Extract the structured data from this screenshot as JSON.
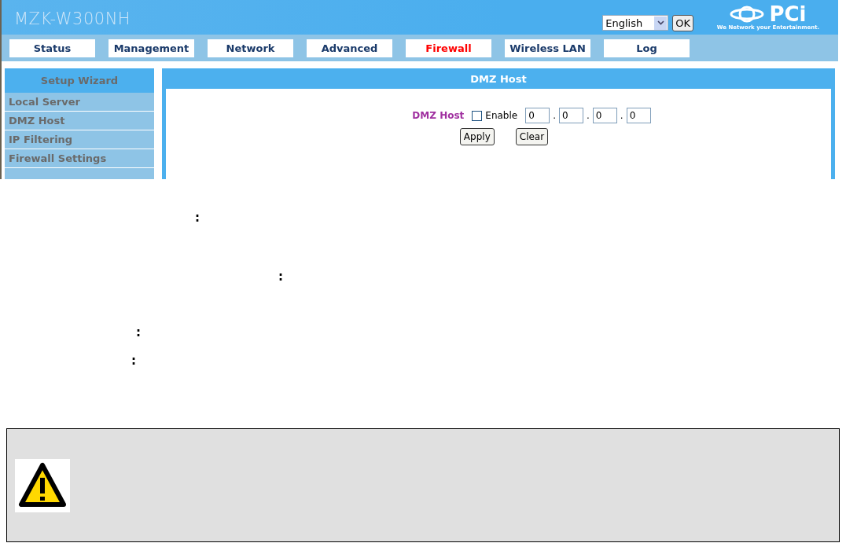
{
  "window": {
    "title": "MZK-W300NH"
  },
  "language": {
    "value": "English",
    "ok": "OK"
  },
  "logo": {
    "brand": "PCi",
    "tagline": "We Network your Entertainment."
  },
  "tabs": [
    {
      "label": "Status",
      "selected": false
    },
    {
      "label": "Management",
      "selected": false
    },
    {
      "label": "Network",
      "selected": false
    },
    {
      "label": "Advanced",
      "selected": false
    },
    {
      "label": "Firewall",
      "selected": true
    },
    {
      "label": "Wireless LAN",
      "selected": false
    },
    {
      "label": "Log",
      "selected": false
    }
  ],
  "sidebar": {
    "title": "Setup Wizard",
    "items": [
      "Local Server",
      "DMZ Host",
      "IP Filtering",
      "Firewall Settings"
    ]
  },
  "panel": {
    "title": "DMZ Host",
    "field_label": "DMZ Host",
    "enable": {
      "label": "Enable",
      "checked": false
    },
    "ip": [
      "0",
      "0",
      "0",
      "0"
    ],
    "separator": ".",
    "buttons": [
      "Apply",
      "Clear"
    ]
  },
  "document": {
    "lines": [
      ":",
      ":",
      ":",
      ":"
    ]
  }
}
